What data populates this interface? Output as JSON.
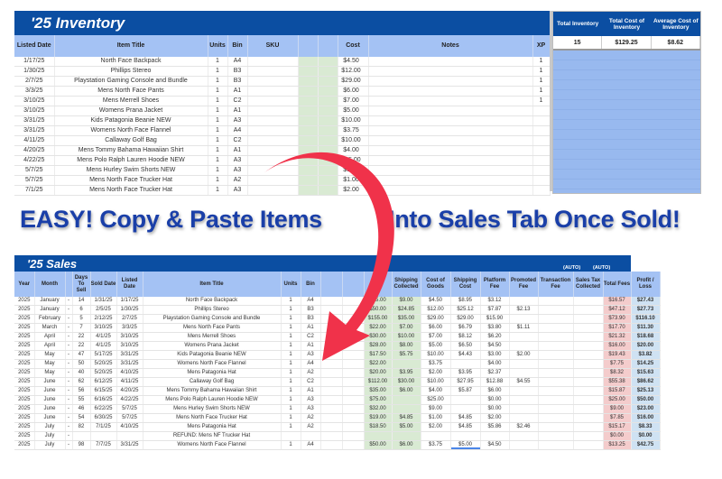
{
  "inventory": {
    "title": "'25 Inventory",
    "columns": [
      "Listed Date",
      "Item Title",
      "Units",
      "Bin",
      "SKU",
      "",
      "",
      "Cost",
      "Notes",
      "XP"
    ],
    "rows": [
      {
        "date": "1/17/25",
        "title": "North Face Backpack",
        "units": "1",
        "bin": "A4",
        "cost": "$4.50",
        "xp": "1"
      },
      {
        "date": "1/30/25",
        "title": "Phillips Stereo",
        "units": "1",
        "bin": "B3",
        "cost": "$12.00",
        "xp": "1"
      },
      {
        "date": "2/7/25",
        "title": "Playstation Gaming Console and Bundle",
        "units": "1",
        "bin": "B3",
        "cost": "$29.00",
        "xp": "1"
      },
      {
        "date": "3/3/25",
        "title": "Mens North Face Pants",
        "units": "1",
        "bin": "A1",
        "cost": "$6.00",
        "xp": "1"
      },
      {
        "date": "3/10/25",
        "title": "Mens Merrell Shoes",
        "units": "1",
        "bin": "C2",
        "cost": "$7.00",
        "xp": "1"
      },
      {
        "date": "3/10/25",
        "title": "Womens Prana Jacket",
        "units": "1",
        "bin": "A1",
        "cost": "$5.00",
        "xp": ""
      },
      {
        "date": "3/31/25",
        "title": "Kids Patagonia Beanie NEW",
        "units": "1",
        "bin": "A3",
        "cost": "$10.00",
        "xp": ""
      },
      {
        "date": "3/31/25",
        "title": "Womens North Face Flannel",
        "units": "1",
        "bin": "A4",
        "cost": "$3.75",
        "xp": ""
      },
      {
        "date": "4/11/25",
        "title": "Callaway Golf Bag",
        "units": "1",
        "bin": "C2",
        "cost": "$10.00",
        "xp": ""
      },
      {
        "date": "4/20/25",
        "title": "Mens Tommy Bahama Hawaiian Shirt",
        "units": "1",
        "bin": "A1",
        "cost": "$4.00",
        "xp": ""
      },
      {
        "date": "4/22/25",
        "title": "Mens Polo Ralph Lauren Hoodie NEW",
        "units": "1",
        "bin": "A3",
        "cost": "$25.00",
        "xp": ""
      },
      {
        "date": "5/7/25",
        "title": "Mens Hurley Swim Shorts NEW",
        "units": "1",
        "bin": "A3",
        "cost": "$9.00",
        "xp": ""
      },
      {
        "date": "5/7/25",
        "title": "Mens North Face Trucker Hat",
        "units": "1",
        "bin": "A2",
        "cost": "$1.00",
        "xp": ""
      },
      {
        "date": "7/1/25",
        "title": "Mens North Face Trucker Hat",
        "units": "1",
        "bin": "A3",
        "cost": "$2.00",
        "xp": ""
      }
    ]
  },
  "stats": {
    "headers": [
      "Total Inventory",
      "Total Cost of Inventory",
      "Average Cost of Inventory"
    ],
    "values": [
      "15",
      "$129.25",
      "$8.62"
    ]
  },
  "headline": {
    "left": "EASY! Copy & Paste Items",
    "right": "Into Sales Tab Once Sold!"
  },
  "sales": {
    "title": "'25 Sales",
    "auto_label": "(AUTO)",
    "columns": [
      "Year",
      "Month",
      "",
      "Days To Sell",
      "Sold Date",
      "Listed Date",
      "Item Title",
      "Units",
      "Bin",
      "",
      "",
      "Sale",
      "Shipping Collected",
      "Cost of Goods",
      "Shipping Cost",
      "Platform Fee",
      "Promoted Fee",
      "Transaction Fee",
      "Sales Tax Collected",
      "Total Fees",
      "Profit / Loss"
    ],
    "rows": [
      {
        "year": "2025",
        "month": "January",
        "days": "14",
        "sold": "1/31/25",
        "listed": "1/17/25",
        "title": "North Face Backpack",
        "units": "1",
        "bin": "A4",
        "sale": "$35.00",
        "ship_col": "$9.00",
        "cogs": "$4.50",
        "ship_cost": "$8.95",
        "platform": "$3.12",
        "promoted": "",
        "txn": "",
        "tax": "",
        "fees": "$16.57",
        "profit": "$27.43"
      },
      {
        "year": "2025",
        "month": "January",
        "days": "6",
        "sold": "2/5/25",
        "listed": "1/30/25",
        "title": "Phillips Stereo",
        "units": "1",
        "bin": "B3",
        "sale": "$50.00",
        "ship_col": "$24.85",
        "cogs": "$12.00",
        "ship_cost": "$25.12",
        "platform": "$7.87",
        "promoted": "$2.13",
        "txn": "",
        "tax": "",
        "fees": "$47.12",
        "profit": "$27.73"
      },
      {
        "year": "2025",
        "month": "February",
        "days": "5",
        "sold": "2/12/25",
        "listed": "2/7/25",
        "title": "Playstation Gaming Console and Bundle",
        "units": "1",
        "bin": "B3",
        "sale": "$155.00",
        "ship_col": "$35.00",
        "cogs": "$29.00",
        "ship_cost": "$29.00",
        "platform": "$15.90",
        "promoted": "",
        "txn": "",
        "tax": "",
        "fees": "$73.90",
        "profit": "$116.10"
      },
      {
        "year": "2025",
        "month": "March",
        "days": "7",
        "sold": "3/10/25",
        "listed": "3/3/25",
        "title": "Mens North Face Pants",
        "units": "1",
        "bin": "A1",
        "sale": "$22.00",
        "ship_col": "$7.00",
        "cogs": "$6.00",
        "ship_cost": "$6.79",
        "platform": "$3.80",
        "promoted": "$1.11",
        "txn": "",
        "tax": "",
        "fees": "$17.70",
        "profit": "$11.30"
      },
      {
        "year": "2025",
        "month": "April",
        "days": "22",
        "sold": "4/1/25",
        "listed": "3/10/25",
        "title": "Mens Merrell Shoes",
        "units": "1",
        "bin": "C2",
        "sale": "$30.00",
        "ship_col": "$10.00",
        "cogs": "$7.00",
        "ship_cost": "$8.12",
        "platform": "$6.20",
        "promoted": "",
        "txn": "",
        "tax": "",
        "fees": "$21.32",
        "profit": "$18.68"
      },
      {
        "year": "2025",
        "month": "April",
        "days": "22",
        "sold": "4/1/25",
        "listed": "3/10/25",
        "title": "Womens Prana Jacket",
        "units": "1",
        "bin": "A1",
        "sale": "$28.00",
        "ship_col": "$8.00",
        "cogs": "$5.00",
        "ship_cost": "$6.50",
        "platform": "$4.50",
        "promoted": "",
        "txn": "",
        "tax": "",
        "fees": "$16.00",
        "profit": "$20.00"
      },
      {
        "year": "2025",
        "month": "May",
        "days": "47",
        "sold": "5/17/25",
        "listed": "3/31/25",
        "title": "Kids Patagonia Beanie NEW",
        "units": "1",
        "bin": "A3",
        "sale": "$17.50",
        "ship_col": "$5.75",
        "cogs": "$10.00",
        "ship_cost": "$4.43",
        "platform": "$3.00",
        "promoted": "$2.00",
        "txn": "",
        "tax": "",
        "fees": "$19.43",
        "profit": "$3.82"
      },
      {
        "year": "2025",
        "month": "May",
        "days": "50",
        "sold": "5/20/25",
        "listed": "3/31/25",
        "title": "Womens North Face Flannel",
        "units": "1",
        "bin": "A4",
        "sale": "$22.00",
        "ship_col": "",
        "cogs": "$3.75",
        "ship_cost": "",
        "platform": "$4.00",
        "promoted": "",
        "txn": "",
        "tax": "",
        "fees": "$7.75",
        "profit": "$14.25"
      },
      {
        "year": "2025",
        "month": "May",
        "days": "40",
        "sold": "5/20/25",
        "listed": "4/10/25",
        "title": "Mens Patagonia Hat",
        "units": "1",
        "bin": "A2",
        "sale": "$20.00",
        "ship_col": "$3.95",
        "cogs": "$2.00",
        "ship_cost": "$3.95",
        "platform": "$2.37",
        "promoted": "",
        "txn": "",
        "tax": "",
        "fees": "$8.32",
        "profit": "$15.63"
      },
      {
        "year": "2025",
        "month": "June",
        "days": "62",
        "sold": "6/12/25",
        "listed": "4/11/25",
        "title": "Callaway Golf Bag",
        "units": "1",
        "bin": "C2",
        "sale": "$112.00",
        "ship_col": "$30.00",
        "cogs": "$10.00",
        "ship_cost": "$27.95",
        "platform": "$12.88",
        "promoted": "$4.55",
        "txn": "",
        "tax": "",
        "fees": "$55.38",
        "profit": "$86.62"
      },
      {
        "year": "2025",
        "month": "June",
        "days": "56",
        "sold": "6/15/25",
        "listed": "4/20/25",
        "title": "Mens Tommy Bahama Hawaiian Shirt",
        "units": "1",
        "bin": "A1",
        "sale": "$35.00",
        "ship_col": "$6.00",
        "cogs": "$4.00",
        "ship_cost": "$5.87",
        "platform": "$6.00",
        "promoted": "",
        "txn": "",
        "tax": "",
        "fees": "$15.87",
        "profit": "$25.13"
      },
      {
        "year": "2025",
        "month": "June",
        "days": "55",
        "sold": "6/16/25",
        "listed": "4/22/25",
        "title": "Mens Polo Ralph Lauren Hoodie NEW",
        "units": "1",
        "bin": "A3",
        "sale": "$75.00",
        "ship_col": "",
        "cogs": "$25.00",
        "ship_cost": "",
        "platform": "$0.00",
        "promoted": "",
        "txn": "",
        "tax": "",
        "fees": "$25.00",
        "profit": "$50.00"
      },
      {
        "year": "2025",
        "month": "June",
        "days": "46",
        "sold": "6/22/25",
        "listed": "5/7/25",
        "title": "Mens Hurley Swim Shorts NEW",
        "units": "1",
        "bin": "A3",
        "sale": "$32.00",
        "ship_col": "",
        "cogs": "$9.00",
        "ship_cost": "",
        "platform": "$0.00",
        "promoted": "",
        "txn": "",
        "tax": "",
        "fees": "$9.00",
        "profit": "$23.00"
      },
      {
        "year": "2025",
        "month": "June",
        "days": "54",
        "sold": "6/30/25",
        "listed": "5/7/25",
        "title": "Mens North Face Trucker Hat",
        "units": "1",
        "bin": "A2",
        "sale": "$19.00",
        "ship_col": "$4.85",
        "cogs": "$1.00",
        "ship_cost": "$4.85",
        "platform": "$2.00",
        "promoted": "",
        "txn": "",
        "tax": "",
        "fees": "$7.85",
        "profit": "$16.00"
      },
      {
        "year": "2025",
        "month": "July",
        "days": "82",
        "sold": "7/1/25",
        "listed": "4/10/25",
        "title": "Mens Patagonia Hat",
        "units": "1",
        "bin": "A2",
        "sale": "$18.50",
        "ship_col": "$5.00",
        "cogs": "$2.00",
        "ship_cost": "$4.85",
        "platform": "$5.86",
        "promoted": "$2.46",
        "txn": "",
        "tax": "",
        "fees": "$15.17",
        "profit": "$8.33"
      },
      {
        "year": "2025",
        "month": "July",
        "days": "",
        "sold": "",
        "listed": "",
        "title": "REFUND: Mens NF Trucker Hat",
        "units": "",
        "bin": "",
        "sale": "",
        "ship_col": "",
        "cogs": "",
        "ship_cost": "",
        "platform": "",
        "promoted": "",
        "txn": "",
        "tax": "",
        "fees": "$0.00",
        "profit": "$0.00"
      },
      {
        "year": "2025",
        "month": "July",
        "days": "98",
        "sold": "7/7/25",
        "listed": "3/31/25",
        "title": "Womens North Face Flannel",
        "units": "1",
        "bin": "A4",
        "sale": "$50.00",
        "ship_col": "$6.00",
        "cogs": "$3.75",
        "ship_cost": "$5.00",
        "platform": "$4.50",
        "promoted": "",
        "txn": "",
        "tax": "",
        "fees": "$13.25",
        "profit": "$42.75"
      }
    ]
  },
  "colors": {
    "banner": "#0b4ea2",
    "header": "#a4c2f4",
    "green": "#d9ead3",
    "pink": "#f4cccc",
    "profit_blue": "#cfe2f3",
    "arrow": "#f0324a",
    "headline": "#1a3fa8"
  }
}
